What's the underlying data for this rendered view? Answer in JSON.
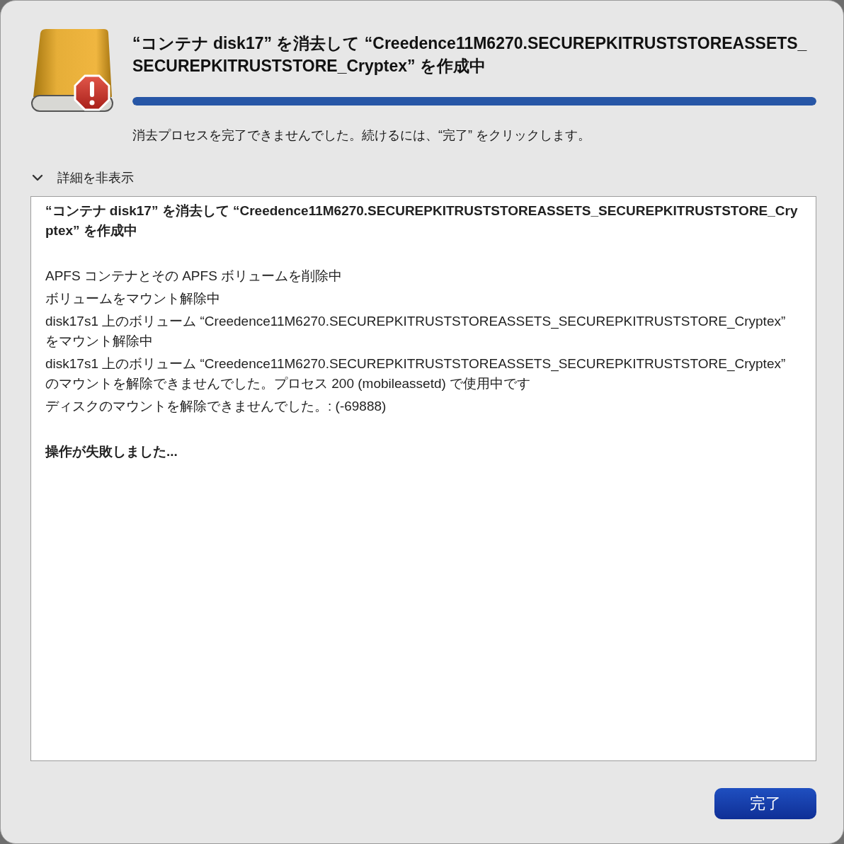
{
  "dialog": {
    "title": "“コンテナ disk17” を消去して “Creedence11M6270.SECUREPKITRUSTSTOREASSETS_SECUREPKITRUSTSTORE_Cryptex” を作成中",
    "progress": {
      "level": 1
    },
    "message": "消去プロセスを完了できませんでした。続けるには、“完了” をクリックします。",
    "details_toggle": {
      "label": "詳細を非表示",
      "expanded": true
    },
    "log": [
      {
        "kind": "heading",
        "text": "“コンテナ disk17” を消去して “Creedence11M6270.SECUREPKITRUSTSTOREASSETS_SECUREPKITRUSTSTORE_Cryptex” を作成中"
      },
      {
        "kind": "line",
        "text": "APFS コンテナとその APFS ボリュームを削除中"
      },
      {
        "kind": "line",
        "text": "ボリュームをマウント解除中"
      },
      {
        "kind": "line",
        "text": "disk17s1 上のボリューム “Creedence11M6270.SECUREPKITRUSTSTOREASSETS_SECUREPKITRUSTSTORE_Cryptex” をマウント解除中"
      },
      {
        "kind": "line",
        "text": "disk17s1 上のボリューム “Creedence11M6270.SECUREPKITRUSTSTOREASSETS_SECUREPKITRUSTSTORE_Cryptex” のマウントを解除できませんでした。プロセス 200 (mobileassetd) で使用中です"
      },
      {
        "kind": "line",
        "text": "ディスクのマウントを解除できませんでした。: (-69888)"
      },
      {
        "kind": "heading",
        "text": "操作が失敗しました..."
      }
    ],
    "buttons": [
      {
        "label": "完了",
        "kind": "default"
      }
    ]
  }
}
